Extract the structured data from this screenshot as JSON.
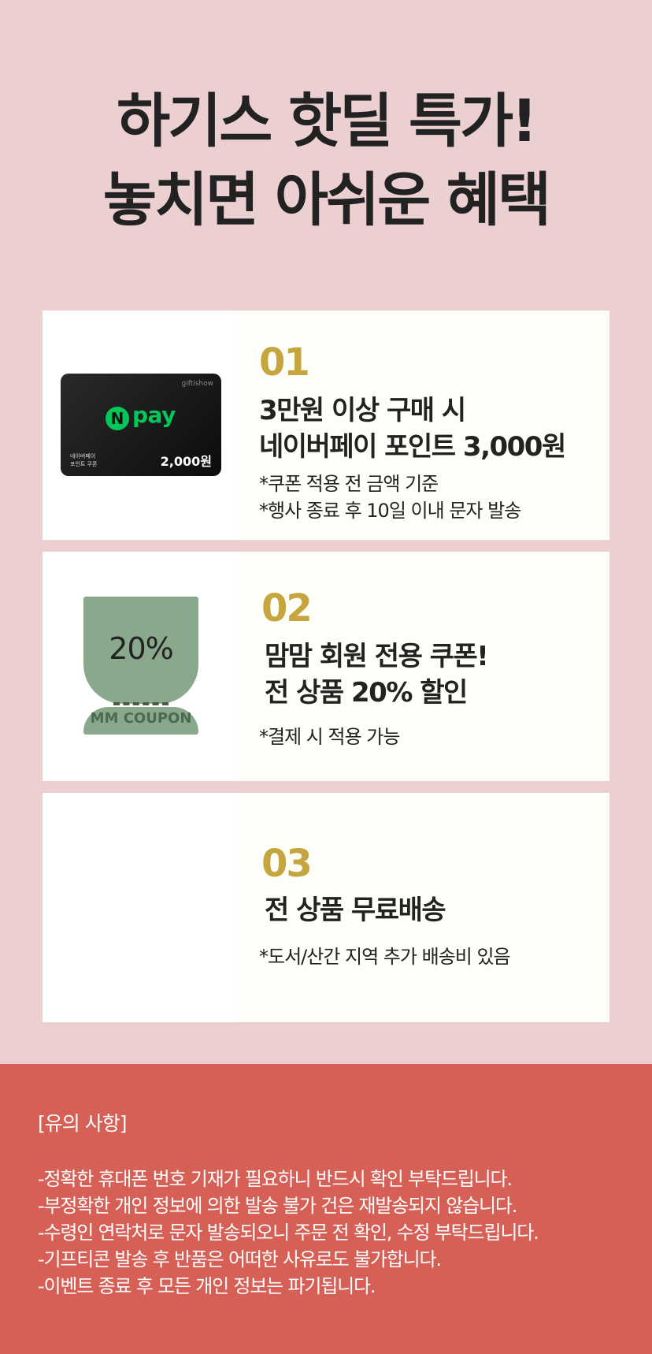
{
  "hero": {
    "title_line1": "하기스 핫딜 특가!",
    "title_line2": "놓치면 아쉬운 혜택"
  },
  "benefits": [
    {
      "number": "01",
      "headline_line1": "3만원 이상 구매 시",
      "headline_line2": "네이버페이 포인트 3,000원",
      "notes": [
        "*쿠폰 적용 전 금액 기준",
        "*행사 종료 후 10일 이내 문자 발송"
      ],
      "coupon": {
        "brand": "giftishow",
        "logo_letter": "N",
        "logo_text": "pay",
        "small_line1": "네이버페이",
        "small_line2": "포인트 쿠폰",
        "amount": "2,000원"
      }
    },
    {
      "number": "02",
      "headline_line1": "맘맘 회원 전용 쿠폰!",
      "headline_line2": "전 상품 20% 할인",
      "notes": [
        "*결제 시 적용 가능"
      ],
      "coupon": {
        "percent": "20%",
        "label": "MM COUPON"
      }
    },
    {
      "number": "03",
      "headline_line1": "전 상품 무료배송",
      "notes": [
        "*도서/산간 지역 추가 배송비 있음"
      ]
    }
  ],
  "notice": {
    "title": "[유의 사항]",
    "lines": [
      "-정확한 휴대폰 번호 기재가 필요하니 반드시 확인 부탁드립니다.",
      "-부정확한 개인 정보에 의한 발송 불가 건은 재발송되지 않습니다.",
      "-수령인 연락처로 문자 발송되오니 주문 전 확인, 수정 부탁드립니다.",
      "-기프티콘 발송 후 반품은 어떠한 사유로도 불가합니다.",
      "-이벤트 종료 후 모든 개인 정보는 파기됩니다."
    ]
  },
  "colors": {
    "background": "#ecd0d1",
    "accent_number": "#c5a63e",
    "notice_background": "#d65f56",
    "npay_green": "#03c75a",
    "coupon_green": "#8aa88c"
  }
}
